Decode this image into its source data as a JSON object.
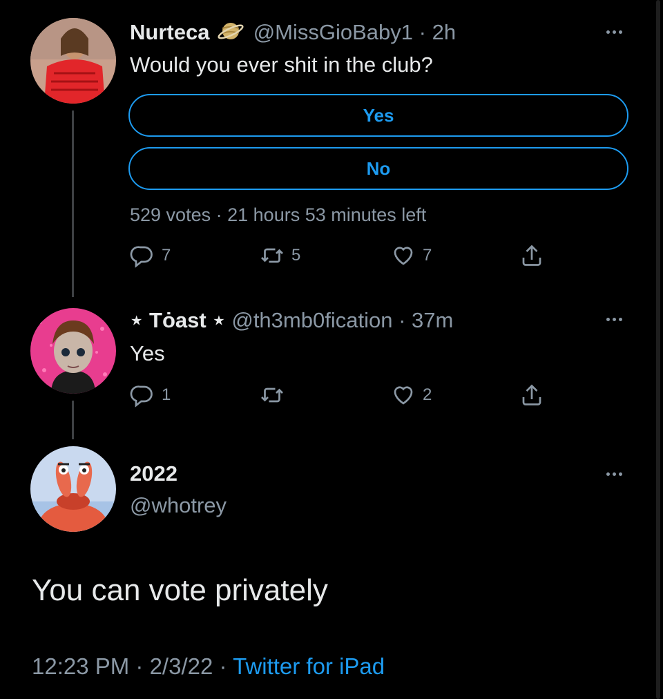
{
  "tweet1": {
    "display_name": "Nurteca",
    "name_emoji": "planet",
    "handle": "@MissGioBaby1",
    "sep": "·",
    "time": "2h",
    "text": "Would you ever shit in the club?",
    "poll": {
      "options": [
        "Yes",
        "No"
      ],
      "votes": "529 votes",
      "sep": "·",
      "time_left": "21 hours 53 minutes left"
    },
    "actions": {
      "replies": "7",
      "retweets": "5",
      "likes": "7"
    }
  },
  "tweet2": {
    "display_name": "⋆ Tȯast ⋆",
    "handle": "@th3mb0fication",
    "sep": "·",
    "time": "37m",
    "text": "Yes",
    "actions": {
      "replies": "1",
      "retweets": "",
      "likes": "2"
    }
  },
  "tweet3": {
    "display_name": "2022",
    "handle": "@whotrey",
    "text": "You can vote privately",
    "timestamp": "12:23 PM · 2/3/22 · ",
    "source": "Twitter for iPad"
  },
  "colors": {
    "accent": "#1d9bf0",
    "muted": "#8b98a5",
    "background": "#000000",
    "text": "#e7e9ea"
  },
  "icons": [
    "reply-icon",
    "retweet-icon",
    "like-icon",
    "share-icon",
    "more-icon",
    "planet-emoji-icon"
  ]
}
